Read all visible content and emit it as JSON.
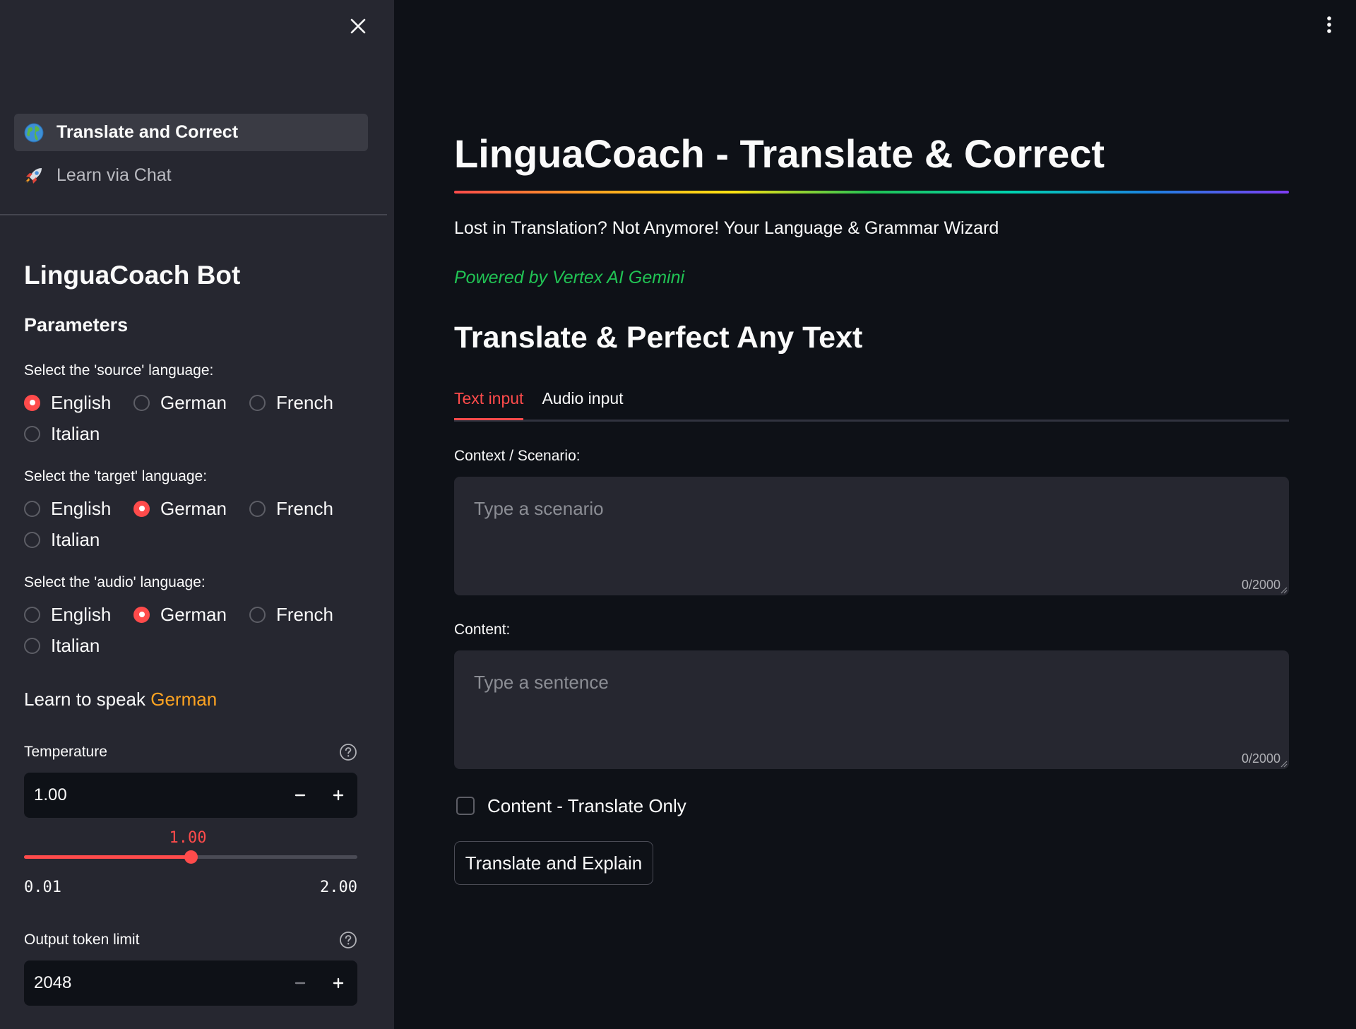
{
  "sidebar": {
    "nav": [
      {
        "label": "Translate and Correct",
        "icon": "globe-icon",
        "active": true
      },
      {
        "label": "Learn via Chat",
        "icon": "rocket-icon",
        "active": false
      }
    ],
    "title": "LinguaCoach Bot",
    "parameters_heading": "Parameters",
    "source": {
      "label": "Select the 'source' language:",
      "options": [
        "English",
        "German",
        "French",
        "Italian"
      ],
      "selected": "English"
    },
    "target": {
      "label": "Select the 'target' language:",
      "options": [
        "English",
        "German",
        "French",
        "Italian"
      ],
      "selected": "German"
    },
    "audio": {
      "label": "Select the 'audio' language:",
      "options": [
        "English",
        "German",
        "French",
        "Italian"
      ],
      "selected": "German"
    },
    "learn": {
      "prefix": "Learn to speak ",
      "language": "German"
    },
    "temperature": {
      "label": "Temperature",
      "value": "1.00",
      "slider_value": "1.00",
      "min": "0.01",
      "max": "2.00",
      "fraction": 0.5
    },
    "token_limit": {
      "label": "Output token limit",
      "value": "2048"
    }
  },
  "main": {
    "title": "LinguaCoach - Translate & Correct",
    "subtitle": "Lost in Translation? Not Anymore! Your Language & Grammar Wizard",
    "powered_by": "Powered by Vertex AI Gemini",
    "section_title": "Translate & Perfect Any Text",
    "tabs": [
      {
        "label": "Text input",
        "active": true
      },
      {
        "label": "Audio input",
        "active": false
      }
    ],
    "context": {
      "label": "Context / Scenario:",
      "placeholder": "Type a scenario",
      "count": "0/2000"
    },
    "content": {
      "label": "Content:",
      "placeholder": "Type a sentence",
      "count": "0/2000"
    },
    "checkbox_label": "Content - Translate Only",
    "button_label": "Translate and Explain"
  },
  "colors": {
    "accent": "#ff4b4b",
    "highlight": "#ffa421",
    "powered": "#21c354",
    "background": "#0e1117",
    "sidebar": "#262730"
  }
}
